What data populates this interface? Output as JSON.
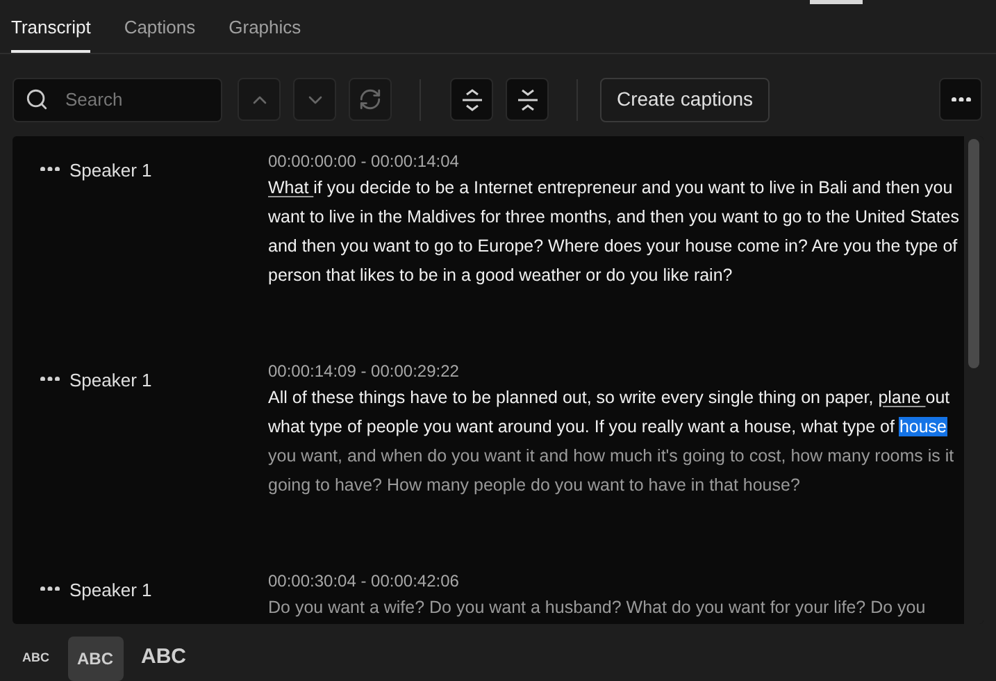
{
  "tabs": [
    {
      "label": "Transcript",
      "selected": true
    },
    {
      "label": "Captions",
      "selected": false
    },
    {
      "label": "Graphics",
      "selected": false
    }
  ],
  "toolbar": {
    "search": {
      "placeholder": "Search"
    },
    "create_button": "Create captions"
  },
  "segments": [
    {
      "speaker": "Speaker 1",
      "time": "00:00:00:00 - 00:00:14:04",
      "runs": [
        {
          "text": "What ",
          "kind": "underline",
          "played": true
        },
        {
          "text": "if you decide to be a Internet entrepreneur and you want to live in Bali and then you want to live in the Maldives for three months, and then you want to go to the United States and then you want to go to Europe? Where does your house come in? Are you the type of person that likes to be in a good weather or do you like rain?",
          "kind": "plain",
          "played": true
        }
      ]
    },
    {
      "speaker": "Speaker 1",
      "time": "00:00:14:09 - 00:00:29:22",
      "runs": [
        {
          "text": "All of these things have to be planned out, so write every single thing on paper, ",
          "kind": "plain",
          "played": true
        },
        {
          "text": "plane ",
          "kind": "underline",
          "played": true
        },
        {
          "text": "out what type of people you want around you. If you really want a house, what type of ",
          "kind": "plain",
          "played": true
        },
        {
          "text": "house",
          "kind": "highlight"
        },
        {
          "text": " you want, and when do you want it and how much it's going to cost, how many rooms is it going to have? How many people do you want to have in that house?",
          "kind": "plain",
          "played": false
        }
      ]
    },
    {
      "speaker": "Speaker 1",
      "time": "00:00:30:04 - 00:00:42:06",
      "runs": [
        {
          "text": "Do you want a wife? Do you want a husband? What do you want for your life? Do you",
          "kind": "plain",
          "played": false
        }
      ]
    }
  ],
  "text_sizes": [
    {
      "label": "ABC",
      "selected": false
    },
    {
      "label": "ABC",
      "selected": true
    },
    {
      "label": "ABC",
      "selected": false
    }
  ]
}
